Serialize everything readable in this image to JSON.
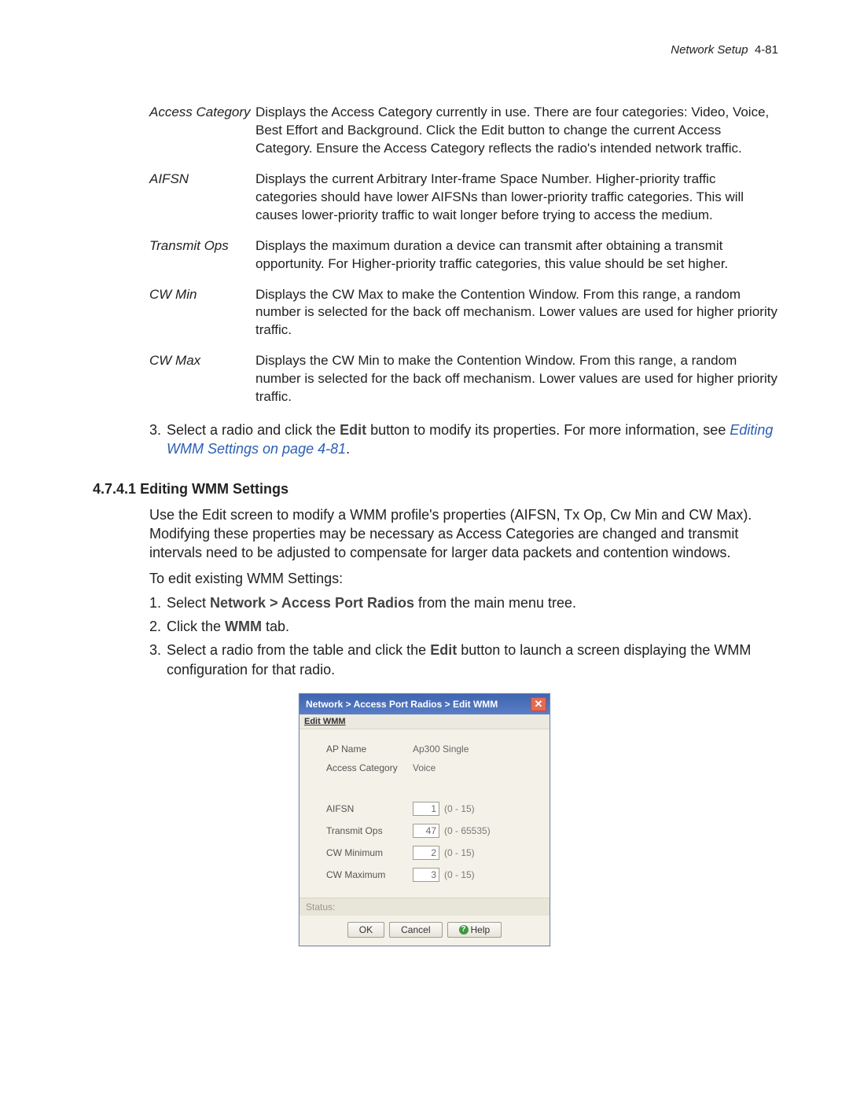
{
  "header": {
    "section_name": "Network Setup",
    "page_ref": "4-81"
  },
  "definitions": [
    {
      "term": "Access Category",
      "desc": "Displays the Access Category currently in use. There are four categories: Video, Voice, Best Effort and Background. Click the Edit button to change the current Access Category. Ensure the Access Category reflects the radio's intended network traffic."
    },
    {
      "term": "AIFSN",
      "desc": "Displays the current Arbitrary Inter-frame Space Number. Higher-priority traffic categories should have lower AIFSNs than lower-priority traffic categories. This will causes lower-priority traffic to wait longer before trying to access the medium."
    },
    {
      "term": "Transmit Ops",
      "desc": "Displays the maximum duration a device can transmit after obtaining a transmit opportunity. For Higher-priority traffic categories, this value should be set higher."
    },
    {
      "term": "CW Min",
      "desc": "Displays the CW Max to make the Contention Window. From this range, a random number is selected for the back off mechanism. Lower values are used for higher priority traffic."
    },
    {
      "term": "CW Max",
      "desc": "Displays the CW Min to make the Contention Window. From this range, a random number is selected for the back off mechanism. Lower values are used for higher priority traffic."
    }
  ],
  "step3": {
    "num": "3.",
    "pre": "Select a radio and click the ",
    "edit": "Edit",
    "mid": " button to modify its properties. For more information, see ",
    "link": "Editing WMM Settings on page 4-81",
    "post": "."
  },
  "section": {
    "number": "4.7.4.1",
    "title": "Editing WMM Settings",
    "p1": "Use the Edit screen to modify a WMM profile's properties (AIFSN, Tx Op, Cw Min and CW Max). Modifying these properties may be necessary as Access Categories are changed and transmit intervals need to be adjusted to compensate for larger data packets and contention windows.",
    "p2": "To edit existing WMM Settings:",
    "li1": {
      "num": "1.",
      "pre": "Select ",
      "bold": "Network > Access Port Radios",
      "post": " from the main menu tree."
    },
    "li2": {
      "num": "2.",
      "pre": "Click the ",
      "bold": "WMM",
      "post": " tab."
    },
    "li3": {
      "num": "3.",
      "pre": "Select a radio from the table and click the ",
      "bold": "Edit",
      "post": " button to launch a screen displaying the WMM configuration for that radio."
    }
  },
  "dialog": {
    "breadcrumb": "Network > Access Port Radios > Edit WMM",
    "close_glyph": "✕",
    "subtitle": "Edit WMM",
    "ap_name_label": "AP Name",
    "ap_name_value": "Ap300 Single",
    "access_cat_label": "Access Category",
    "access_cat_value": "Voice",
    "fields": {
      "aifsn": {
        "label": "AIFSN",
        "value": "1",
        "range": "(0 - 15)"
      },
      "transmit_ops": {
        "label": "Transmit Ops",
        "value": "47",
        "range": "(0 - 65535)"
      },
      "cw_min": {
        "label": "CW Minimum",
        "value": "2",
        "range": "(0 - 15)"
      },
      "cw_max": {
        "label": "CW Maximum",
        "value": "3",
        "range": "(0 - 15)"
      }
    },
    "status_label": "Status:",
    "buttons": {
      "ok": "OK",
      "cancel": "Cancel",
      "help": "Help",
      "help_glyph": "?"
    }
  }
}
